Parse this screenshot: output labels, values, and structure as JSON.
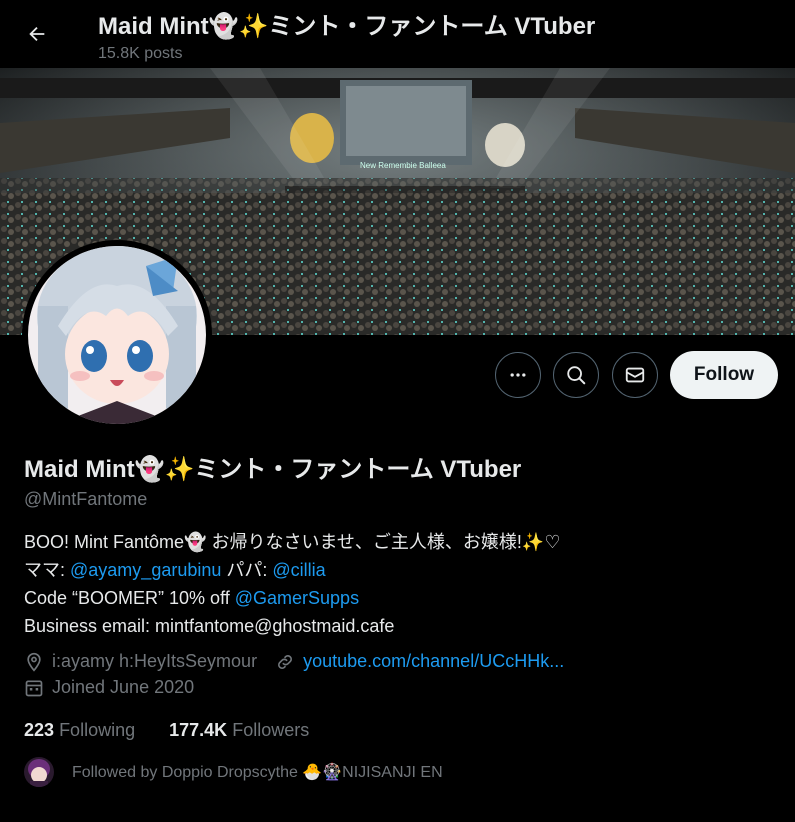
{
  "header": {
    "title": "Maid Mint👻✨ミント・ファントーム VTuber",
    "posts": "15.8K posts"
  },
  "banner": {
    "screen_text": "New Remembie Balleea"
  },
  "actions": {
    "follow_label": "Follow"
  },
  "profile": {
    "name": "Maid Mint👻✨ミント・ファントーム VTuber",
    "handle": "@MintFantome",
    "bio": {
      "line1": "BOO! Mint Fantôme👻 お帰りなさいませ、ご主人様、お嬢様!✨♡",
      "line2_prefix": "ママ: ",
      "line2_mama": "@ayamy_garubinu",
      "line2_mid": " パパ: ",
      "line2_papa": "@cillia",
      "line3_prefix": "Code “BOOMER” 10% off ",
      "line3_link": "@GamerSupps",
      "line4": "Business email: mintfantome@ghostmaid.cafe"
    },
    "location": "i:ayamy h:HeyItsSeymour",
    "website": "youtube.com/channel/UCcHHk...",
    "joined": "Joined June 2020",
    "following_count": "223",
    "following_label": "Following",
    "followers_count": "177.4K",
    "followers_label": "Followers",
    "followed_by": "Followed by Doppio Dropscythe 🐣🎡NIJISANJI EN"
  },
  "colors": {
    "accent": "#1d9bf0",
    "muted": "#71767b",
    "text": "#e7e9ea",
    "background": "#000000"
  },
  "icons": [
    "back-arrow-icon",
    "more-icon",
    "search-icon",
    "mail-icon",
    "location-icon",
    "link-icon",
    "calendar-icon"
  ]
}
